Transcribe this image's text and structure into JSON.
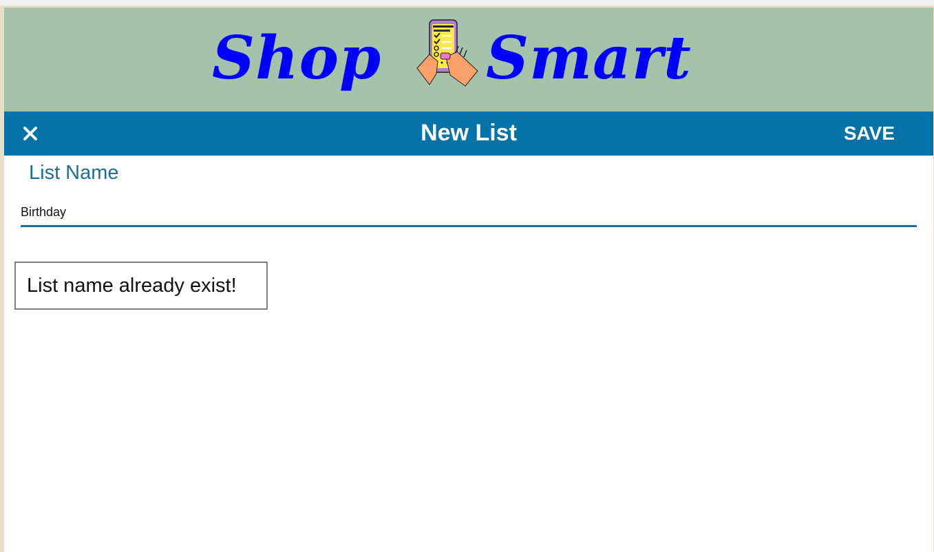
{
  "header": {
    "logo_word_1": "Shop",
    "logo_word_2": "Smart",
    "logo_icon": "phone-shopping-list-icon",
    "logo_color": "#0000ff",
    "banner_color": "#a4c3aa"
  },
  "toolbar": {
    "close_icon": "close-icon",
    "close_glyph": "✕",
    "title": "New List",
    "save_label": "SAVE",
    "background_color": "#0572a8"
  },
  "form": {
    "list_name_label": "List Name",
    "list_name_value": "Birthday",
    "accent_color": "#1b6fa0"
  },
  "error": {
    "message": "List name already exist!"
  }
}
